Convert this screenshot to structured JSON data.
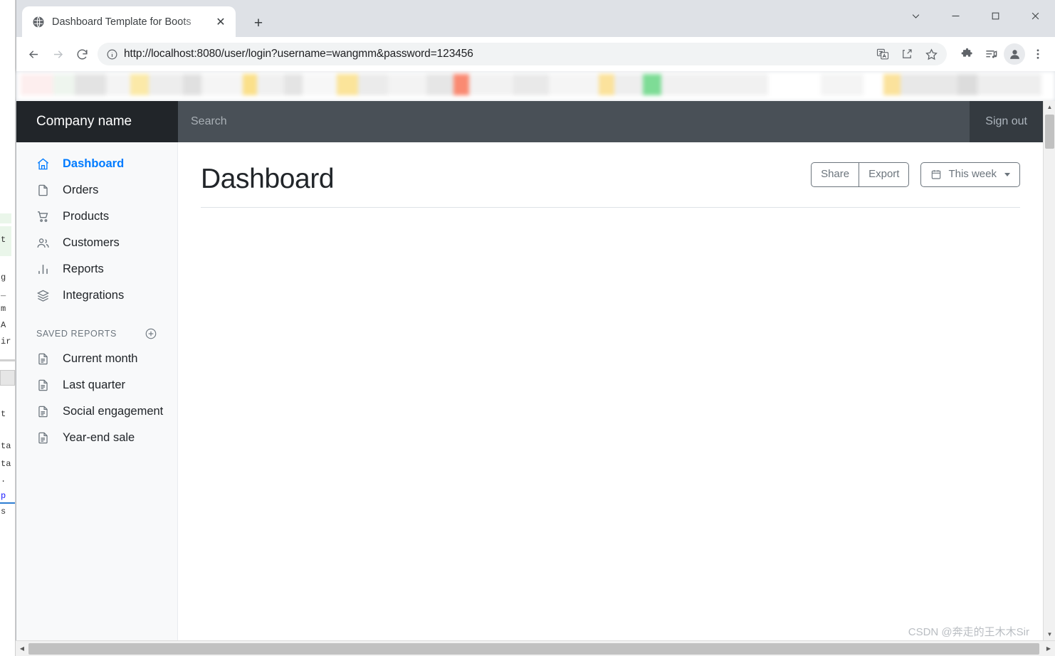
{
  "browser": {
    "tab": {
      "title": "Dashboard Template for Boots",
      "favicon_icon": "globe-icon",
      "close_icon": "close-icon"
    },
    "new_tab_label": "+",
    "window_controls": {
      "tab_search_icon": "chevron-down-icon",
      "minimize_icon": "minimize-icon",
      "maximize_icon": "maximize-icon",
      "close_icon": "close-icon"
    },
    "toolbar": {
      "back_icon": "arrow-left-icon",
      "forward_icon": "arrow-right-icon",
      "reload_icon": "reload-icon",
      "site_info_icon": "info-circle-icon",
      "url": "http://localhost:8080/user/login?username=wangmm&password=123456",
      "translate_icon": "translate-icon",
      "share_icon": "share-icon",
      "bookmark_icon": "star-icon",
      "extensions_icon": "puzzle-icon",
      "media_icon": "media-playlist-icon",
      "profile_icon": "profile-avatar-icon",
      "menu_icon": "three-dot-menu-icon"
    }
  },
  "app": {
    "brand": "Company name",
    "search": {
      "value": "",
      "placeholder": "Search"
    },
    "sign_out_label": "Sign out"
  },
  "sidebar": {
    "nav": [
      {
        "label": "Dashboard",
        "icon": "home-icon",
        "active": true
      },
      {
        "label": "Orders",
        "icon": "file-icon",
        "active": false
      },
      {
        "label": "Products",
        "icon": "cart-icon",
        "active": false
      },
      {
        "label": "Customers",
        "icon": "users-icon",
        "active": false
      },
      {
        "label": "Reports",
        "icon": "bar-chart-icon",
        "active": false
      },
      {
        "label": "Integrations",
        "icon": "layers-icon",
        "active": false
      }
    ],
    "section": {
      "title": "SAVED REPORTS",
      "add_icon": "plus-circle-icon",
      "items": [
        {
          "label": "Current month",
          "icon": "document-icon"
        },
        {
          "label": "Last quarter",
          "icon": "document-icon"
        },
        {
          "label": "Social engagement",
          "icon": "document-icon"
        },
        {
          "label": "Year-end sale",
          "icon": "document-icon"
        }
      ]
    }
  },
  "main": {
    "title": "Dashboard",
    "actions": {
      "share_label": "Share",
      "export_label": "Export",
      "range_label": "This week",
      "range_icon": "calendar-icon",
      "range_caret_icon": "caret-down-icon"
    }
  },
  "watermark": "CSDN @奔走的王木木Sir",
  "colors": {
    "navbar_bg": "#343a40",
    "brand_bg": "#212529",
    "search_bg": "#495057",
    "sidebar_bg": "#f8f9fa",
    "accent": "#007bff",
    "muted": "#6c757d"
  }
}
